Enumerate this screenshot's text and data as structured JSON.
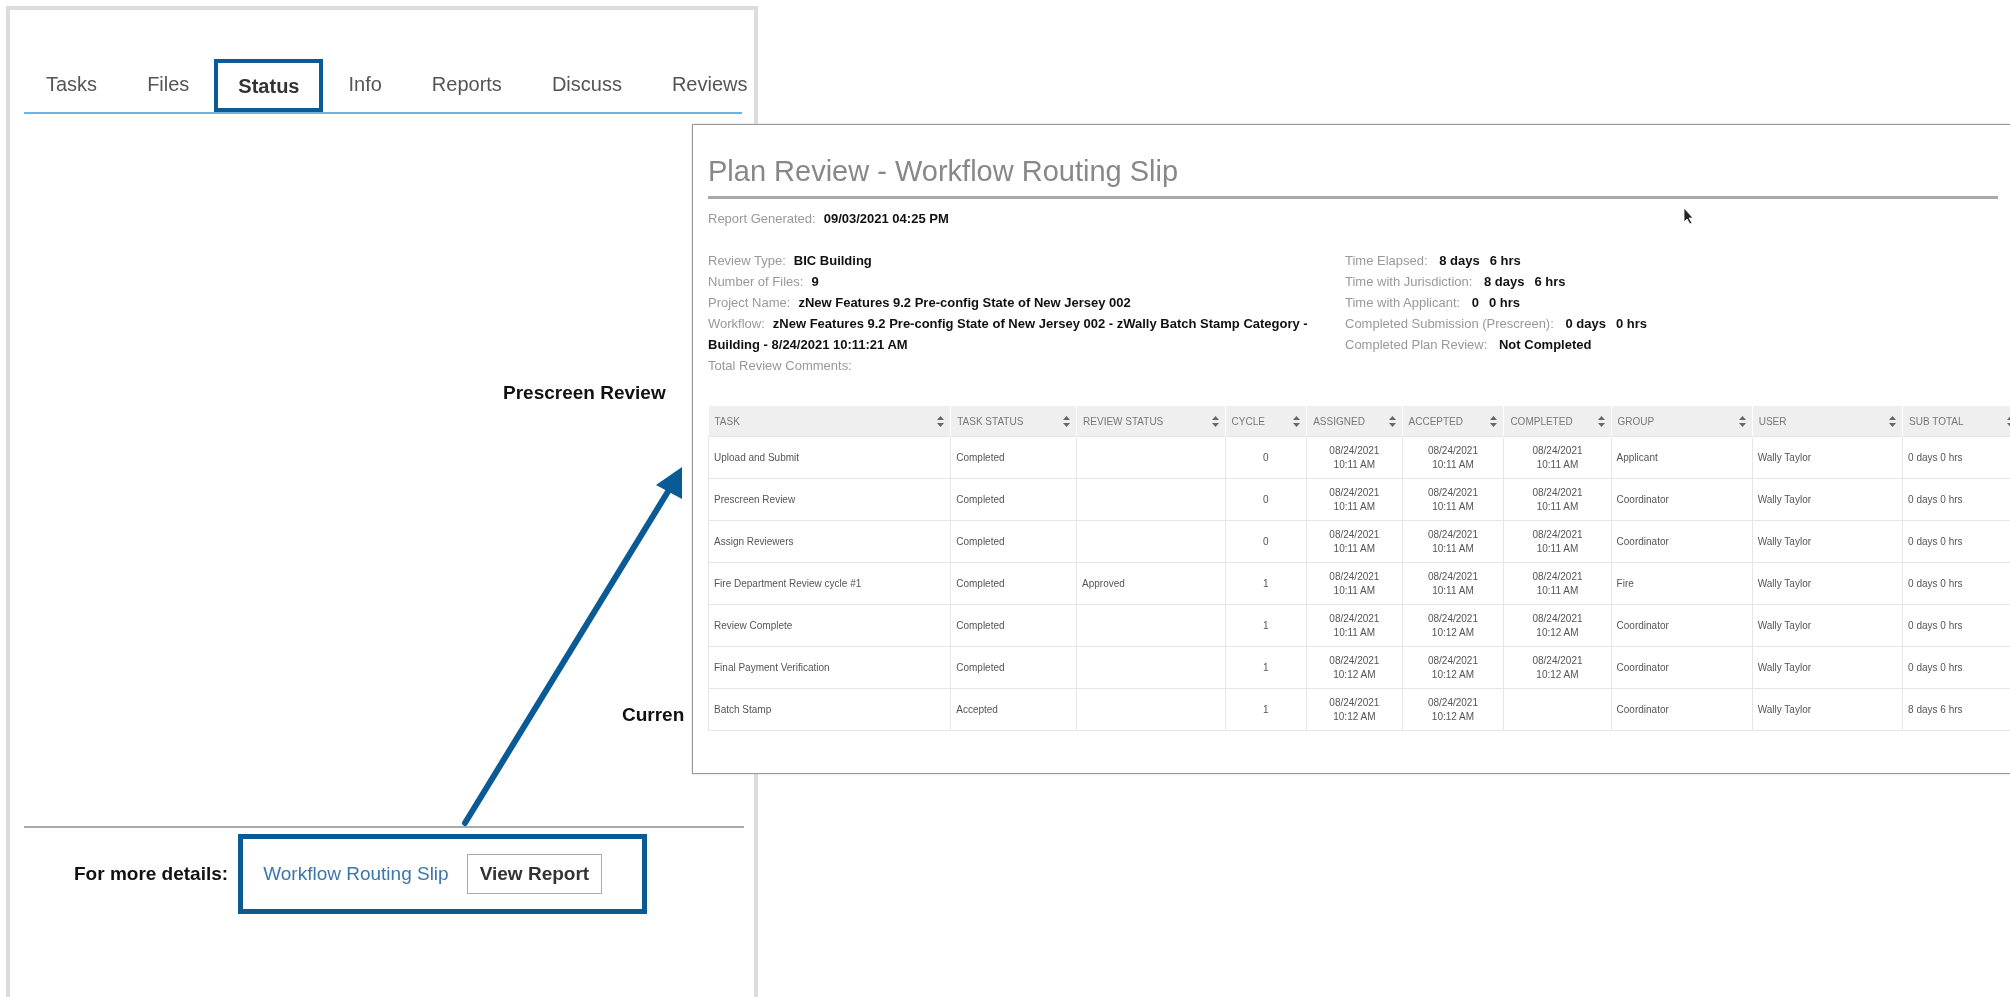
{
  "tabs": [
    {
      "label": "Tasks",
      "selected": false
    },
    {
      "label": "Files",
      "selected": false
    },
    {
      "label": "Status",
      "selected": true
    },
    {
      "label": "Info",
      "selected": false
    },
    {
      "label": "Reports",
      "selected": false
    },
    {
      "label": "Discuss",
      "selected": false
    },
    {
      "label": "Reviews",
      "selected": false
    }
  ],
  "status_headings": [
    "Prescreen Review",
    "Curren"
  ],
  "footer": {
    "label": "For more details:",
    "link": "Workflow Routing Slip",
    "button": "View Report"
  },
  "report": {
    "title": "Plan Review - Workflow Routing Slip",
    "generated": {
      "label": "Report Generated:",
      "value": "09/03/2021 04:25 PM"
    },
    "details_left": [
      {
        "label": "Review Type:",
        "value": "BIC Building"
      },
      {
        "label": "Number of Files:",
        "value": "9"
      },
      {
        "label": "Project Name:",
        "value": "zNew Features 9.2 Pre-config State of New Jersey 002"
      },
      {
        "label": "Workflow:",
        "value": "zNew Features 9.2 Pre-config State of New Jersey 002 - zWally Batch Stamp Category - Building - 8/24/2021 10:11:21 AM"
      },
      {
        "label": "Total Review Comments:"
      }
    ],
    "details_right": [
      {
        "label": "Time Elapsed:",
        "parts": [
          "8 days",
          "6 hrs"
        ]
      },
      {
        "label": "Time with Jurisdiction:",
        "parts": [
          "8 days",
          "6 hrs"
        ]
      },
      {
        "label": "Time with Applicant:",
        "parts": [
          "0",
          "0 hrs"
        ]
      },
      {
        "label": "Completed Submission (Prescreen):",
        "parts": [
          "0 days",
          "0 hrs"
        ]
      },
      {
        "label": "Completed Plan Review:",
        "parts": [
          "Not Completed"
        ]
      }
    ],
    "table": {
      "columns": [
        "TASK",
        "TASK STATUS",
        "REVIEW STATUS",
        "CYCLE",
        "ASSIGNED",
        "ACCEPTED",
        "COMPLETED",
        "GROUP",
        "USER",
        "SUB TOTAL"
      ],
      "rows": [
        [
          "Upload and Submit",
          "Completed",
          "",
          "0",
          "08/24/2021 10:11 AM",
          "08/24/2021 10:11 AM",
          "08/24/2021 10:11 AM",
          "Applicant",
          "Wally Taylor",
          "0 days 0 hrs"
        ],
        [
          "Prescreen Review",
          "Completed",
          "",
          "0",
          "08/24/2021 10:11 AM",
          "08/24/2021 10:11 AM",
          "08/24/2021 10:11 AM",
          "Coordinator",
          "Wally Taylor",
          "0 days 0 hrs"
        ],
        [
          "Assign Reviewers",
          "Completed",
          "",
          "0",
          "08/24/2021 10:11 AM",
          "08/24/2021 10:11 AM",
          "08/24/2021 10:11 AM",
          "Coordinator",
          "Wally Taylor",
          "0 days 0 hrs"
        ],
        [
          "Fire Department Review cycle #1",
          "Completed",
          "Approved",
          "1",
          "08/24/2021 10:11 AM",
          "08/24/2021 10:11 AM",
          "08/24/2021 10:11 AM",
          "Fire",
          "Wally Taylor",
          "0 days 0 hrs"
        ],
        [
          "Review Complete",
          "Completed",
          "",
          "1",
          "08/24/2021 10:11 AM",
          "08/24/2021 10:12 AM",
          "08/24/2021 10:12 AM",
          "Coordinator",
          "Wally Taylor",
          "0 days 0 hrs"
        ],
        [
          "Final Payment Verification",
          "Completed",
          "",
          "1",
          "08/24/2021 10:12 AM",
          "08/24/2021 10:12 AM",
          "08/24/2021 10:12 AM",
          "Coordinator",
          "Wally Taylor",
          "0 days 0 hrs"
        ],
        [
          "Batch Stamp",
          "Accepted",
          "",
          "1",
          "08/24/2021 10:12 AM",
          "08/24/2021 10:12 AM",
          "",
          "Coordinator",
          "Wally Taylor",
          "8 days 6 hrs"
        ]
      ]
    }
  }
}
